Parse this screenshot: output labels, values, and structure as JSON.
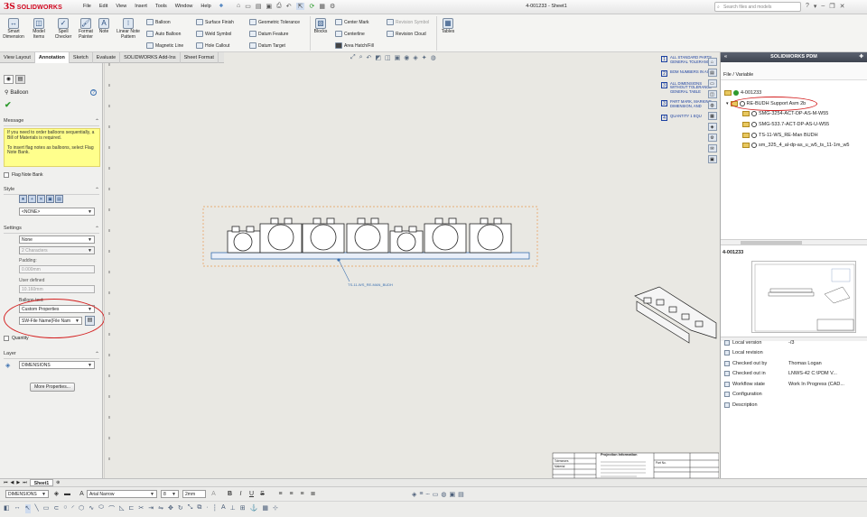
{
  "app": {
    "brand_ds": "3S",
    "brand_name": "SOLIDWORKS"
  },
  "menu": [
    "File",
    "Edit",
    "View",
    "Insert",
    "Tools",
    "Window",
    "Help"
  ],
  "window_title": "4-001233 - Sheet1",
  "search": {
    "placeholder": "Search files and models"
  },
  "ribbon": {
    "smart_dimension": "Smart Dimension",
    "model_items": "Model Items",
    "spell_checker": "Spell Checker",
    "format_painter": "Format Painter",
    "note": "Note",
    "linear_note_pattern": "Linear Note Pattern",
    "balloon": "Balloon",
    "auto_balloon": "Auto Balloon",
    "magnetic_line": "Magnetic Line",
    "surface_finish": "Surface Finish",
    "weld_symbol": "Weld Symbol",
    "hole_callout": "Hole Callout",
    "geometric_tolerance": "Geometric Tolerance",
    "datum_feature": "Datum Feature",
    "datum_target": "Datum Target",
    "blocks": "Blocks",
    "center_mark": "Center Mark",
    "centerline": "Centerline",
    "area_hatch": "Area Hatch/Fill",
    "revision_symbol": "Revision Symbol",
    "revision_cloud": "Revision Cloud",
    "tables": "Tables"
  },
  "cmd_tabs": [
    "View Layout",
    "Annotation",
    "Sketch",
    "Evaluate",
    "SOLIDWORKS Add-Ins",
    "Sheet Format"
  ],
  "propertymanager": {
    "title": "Balloon",
    "message_heading": "Message",
    "message_p1": "If you need to order balloons sequentially, a Bill of Materials is required.",
    "message_p2": "To insert flag notes as balloons, select Flag Note Bank.",
    "flag_note_bank": "Flag Note Bank",
    "style_heading": "Style",
    "style_value": "<NONE>",
    "settings_heading": "Settings",
    "settings_style": "None",
    "settings_size": "2 Characters",
    "padding_label": "Padding:",
    "padding_value": "0.000mm",
    "user_defined_label": "User defined",
    "user_defined_value": "10.160mm",
    "balloon_text_label": "Balloon text:",
    "balloon_text_value": "Custom Properties",
    "property_value": "SW-File Name(File Nam",
    "quantity": "Quantity",
    "layer_heading": "Layer",
    "layer_value": "DIMENSIONS",
    "more_properties": "More Properties..."
  },
  "drawing": {
    "balloon_leader_text": "TS-11-WS_RE-MAN_BUDH",
    "notes": [
      {
        "num": "1",
        "text": "ALL STANDARD PARTS GENERAL TOLERANCE"
      },
      {
        "num": "2",
        "text": "BOM NUMBERS IN ACC"
      },
      {
        "num": "3",
        "text": "ALL DIMENSIONS WITHOUT TOLERANCE GENERAL TABLE"
      },
      {
        "num": "3",
        "text": "PART MARK, MARKING DIMENSION, AND"
      },
      {
        "num": "4",
        "text": "QUANTITY 1 EQU"
      }
    ],
    "title_block_fields": [
      "Projection Information",
      "Tolerances",
      "Material",
      "Part No."
    ]
  },
  "pdm": {
    "title": "SOLIDWORKS PDM",
    "col_header": "File / Variable",
    "tree": [
      {
        "label": "4-001233",
        "level": 0
      },
      {
        "label": "RE-BUDH Support Asm 2b",
        "level": 1
      },
      {
        "label": "SMG-3254-ACT-DP-AS-M-W55",
        "level": 2
      },
      {
        "label": "SMG-533.7-ACT-DP-AS-U-W55",
        "level": 2
      },
      {
        "label": "TS-11-WS_RE-Man BUDH",
        "level": 2
      },
      {
        "label": "sm_325_4_al-dp-as_u_w5_ts_11-1m_w5",
        "level": 2
      }
    ],
    "preview_label": "4-001233",
    "properties": [
      {
        "key": "Local version",
        "value": "-/3"
      },
      {
        "key": "Local revision",
        "value": ""
      },
      {
        "key": "Checked out by",
        "value": "Thomas Logan"
      },
      {
        "key": "Checked out in",
        "value": "LNWS-42  C:\\PDM V..."
      },
      {
        "key": "Workflow state",
        "value": "Work In Progress (CAD..."
      },
      {
        "key": "Configuration",
        "value": ""
      },
      {
        "key": "Description",
        "value": ""
      }
    ]
  },
  "sheet_tab": "Sheet1",
  "format_bar": {
    "layer": "DIMENSIONS",
    "font": "Arial Narrow",
    "size": "8",
    "height": "2mm"
  }
}
